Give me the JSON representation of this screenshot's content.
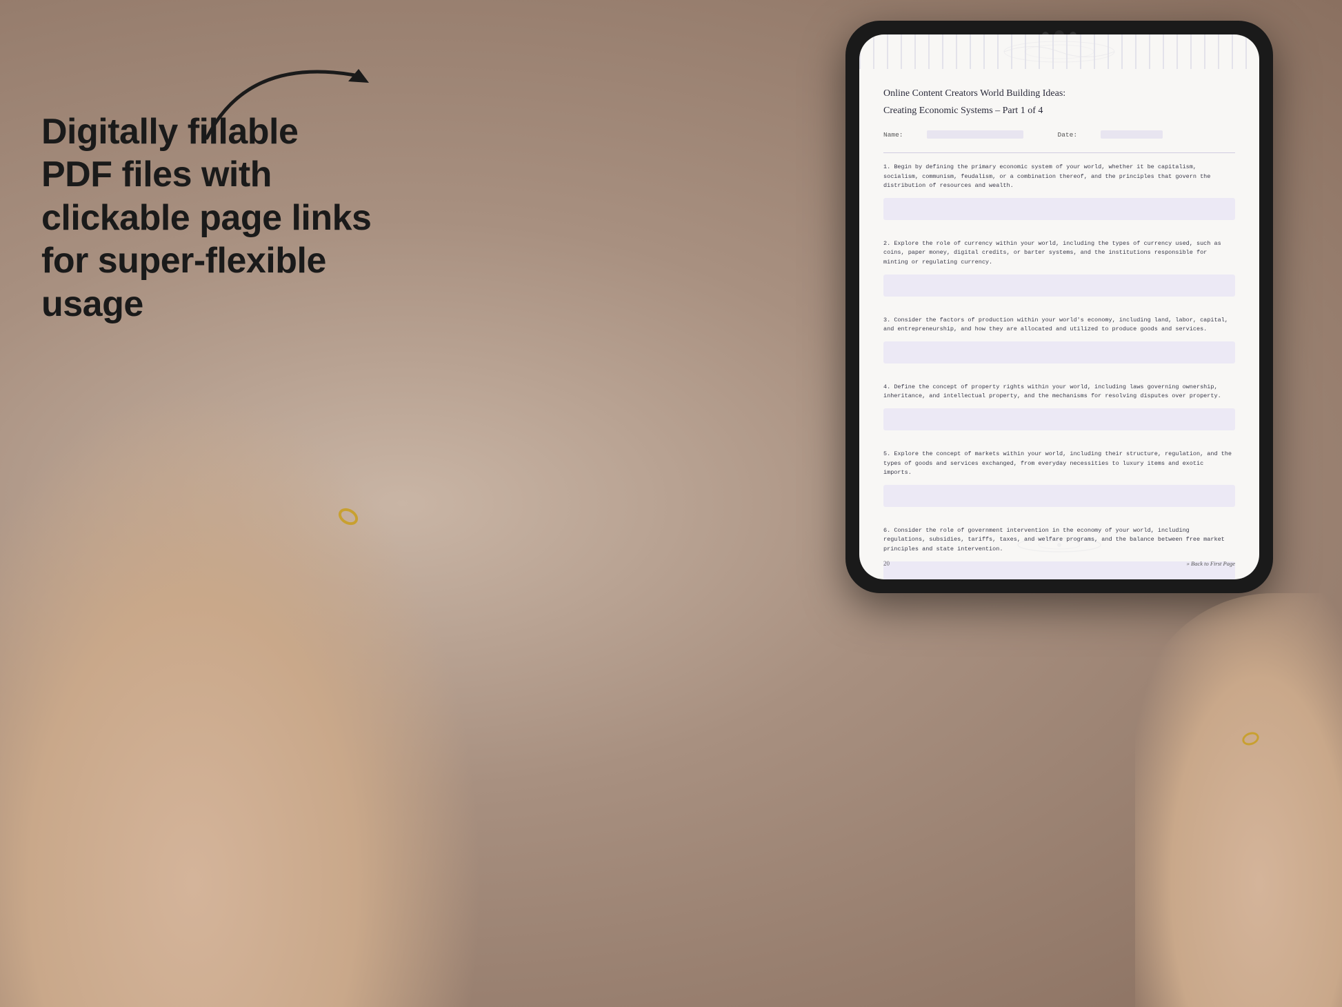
{
  "background": {
    "color": "#b8a89a"
  },
  "left_panel": {
    "main_label": "Digitally fillable PDF files with clickable page links for super-flexible usage"
  },
  "arrow": {
    "description": "curved arrow pointing right toward tablet"
  },
  "tablet": {
    "pdf": {
      "title_line1": "Online Content Creators World Building Ideas:",
      "title_line2": "Creating Economic Systems – Part 1 of 4",
      "name_label": "Name:",
      "date_label": "Date:",
      "items": [
        {
          "number": "1.",
          "text": "Begin by defining the primary economic system of your world, whether it be capitalism, socialism, communism, feudalism, or a combination thereof, and the principles that govern the distribution of resources and wealth."
        },
        {
          "number": "2.",
          "text": "Explore the role of currency within your world, including the types of currency used, such as coins, paper money, digital credits, or barter systems, and the institutions responsible for minting or regulating currency."
        },
        {
          "number": "3.",
          "text": "Consider the factors of production within your world's economy, including land, labor, capital, and entrepreneurship, and how they are allocated and utilized to produce goods and services."
        },
        {
          "number": "4.",
          "text": "Define the concept of property rights within your world, including laws governing ownership, inheritance, and intellectual property, and the mechanisms for resolving disputes over property."
        },
        {
          "number": "5.",
          "text": "Explore the concept of markets within your world, including their structure, regulation, and the types of goods and services exchanged, from everyday necessities to luxury items and exotic imports."
        },
        {
          "number": "6.",
          "text": "Consider the role of government intervention in the economy of your world, including regulations, subsidies, tariffs, taxes, and welfare programs, and the balance between free market principles and state intervention."
        }
      ],
      "page_number": "20",
      "back_link": "» Back to First Page"
    }
  }
}
